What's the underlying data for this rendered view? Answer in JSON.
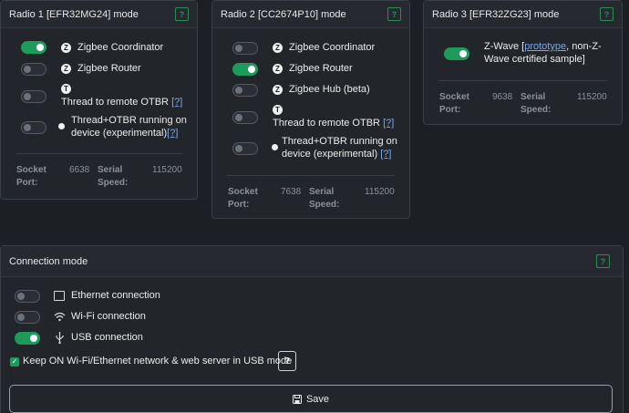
{
  "radio1": {
    "title": "Radio 1 [EFR32MG24] mode",
    "help": "?",
    "options": [
      {
        "label": "Zigbee Coordinator",
        "on": true
      },
      {
        "label": "Zigbee Router",
        "on": false
      },
      {
        "label": "Thread to remote OTBR",
        "link": "[?]",
        "on": false
      },
      {
        "label_line1": "Thread+OTBR running on",
        "label_line2": "device (experimental)",
        "link": "[?]",
        "on": false
      }
    ],
    "socket_port_label_1": "Socket",
    "socket_port_label_2": "Port:",
    "socket_port_value": "6638",
    "serial_speed_label_1": "Serial",
    "serial_speed_label_2": "Speed:",
    "serial_speed_value": "115200"
  },
  "radio2": {
    "title": "Radio 2 [CC2674P10] mode",
    "help": "?",
    "options": [
      {
        "label": "Zigbee Coordinator",
        "on": false
      },
      {
        "label": "Zigbee Router",
        "on": true
      },
      {
        "label": "Zigbee Hub (beta)",
        "on": false
      },
      {
        "label": "Thread to remote OTBR",
        "link": "[?]",
        "on": false
      },
      {
        "label_line1": "Thread+OTBR running on",
        "label_line2": "device (experimental)",
        "link": "[?]",
        "on": false
      }
    ],
    "socket_port_label_1": "Socket",
    "socket_port_label_2": "Port:",
    "socket_port_value": "7638",
    "serial_speed_label_1": "Serial",
    "serial_speed_label_2": "Speed:",
    "serial_speed_value": "115200"
  },
  "radio3": {
    "title": "Radio 3 [EFR32ZG23] mode",
    "help": "?",
    "option": {
      "label_pre": "Z-Wave [",
      "link": "prototype",
      "label_post": ", non-Z-",
      "label_line2": "Wave certified sample]",
      "on": true
    },
    "socket_port_label_1": "Socket",
    "socket_port_label_2": "Port:",
    "socket_port_value": "9638",
    "serial_speed_label_1": "Serial",
    "serial_speed_label_2": "Speed:",
    "serial_speed_value": "115200"
  },
  "connection": {
    "title": "Connection mode",
    "help": "?",
    "options": [
      {
        "label": "Ethernet connection",
        "icon": "ethernet-icon",
        "on": false
      },
      {
        "label": "Wi-Fi connection",
        "icon": "wifi-icon",
        "on": false
      },
      {
        "label": "USB connection",
        "icon": "usb-icon",
        "on": true
      }
    ],
    "keep_on_label": "Keep ON Wi-Fi/Ethernet network & web server in USB mode",
    "keep_on_checked": true,
    "keep_on_help": "?"
  },
  "save_label": "Save",
  "colors": {
    "accent": "#1e9a5a",
    "background": "#1c1f24",
    "card": "#22262b",
    "link": "#7aa7e6"
  }
}
